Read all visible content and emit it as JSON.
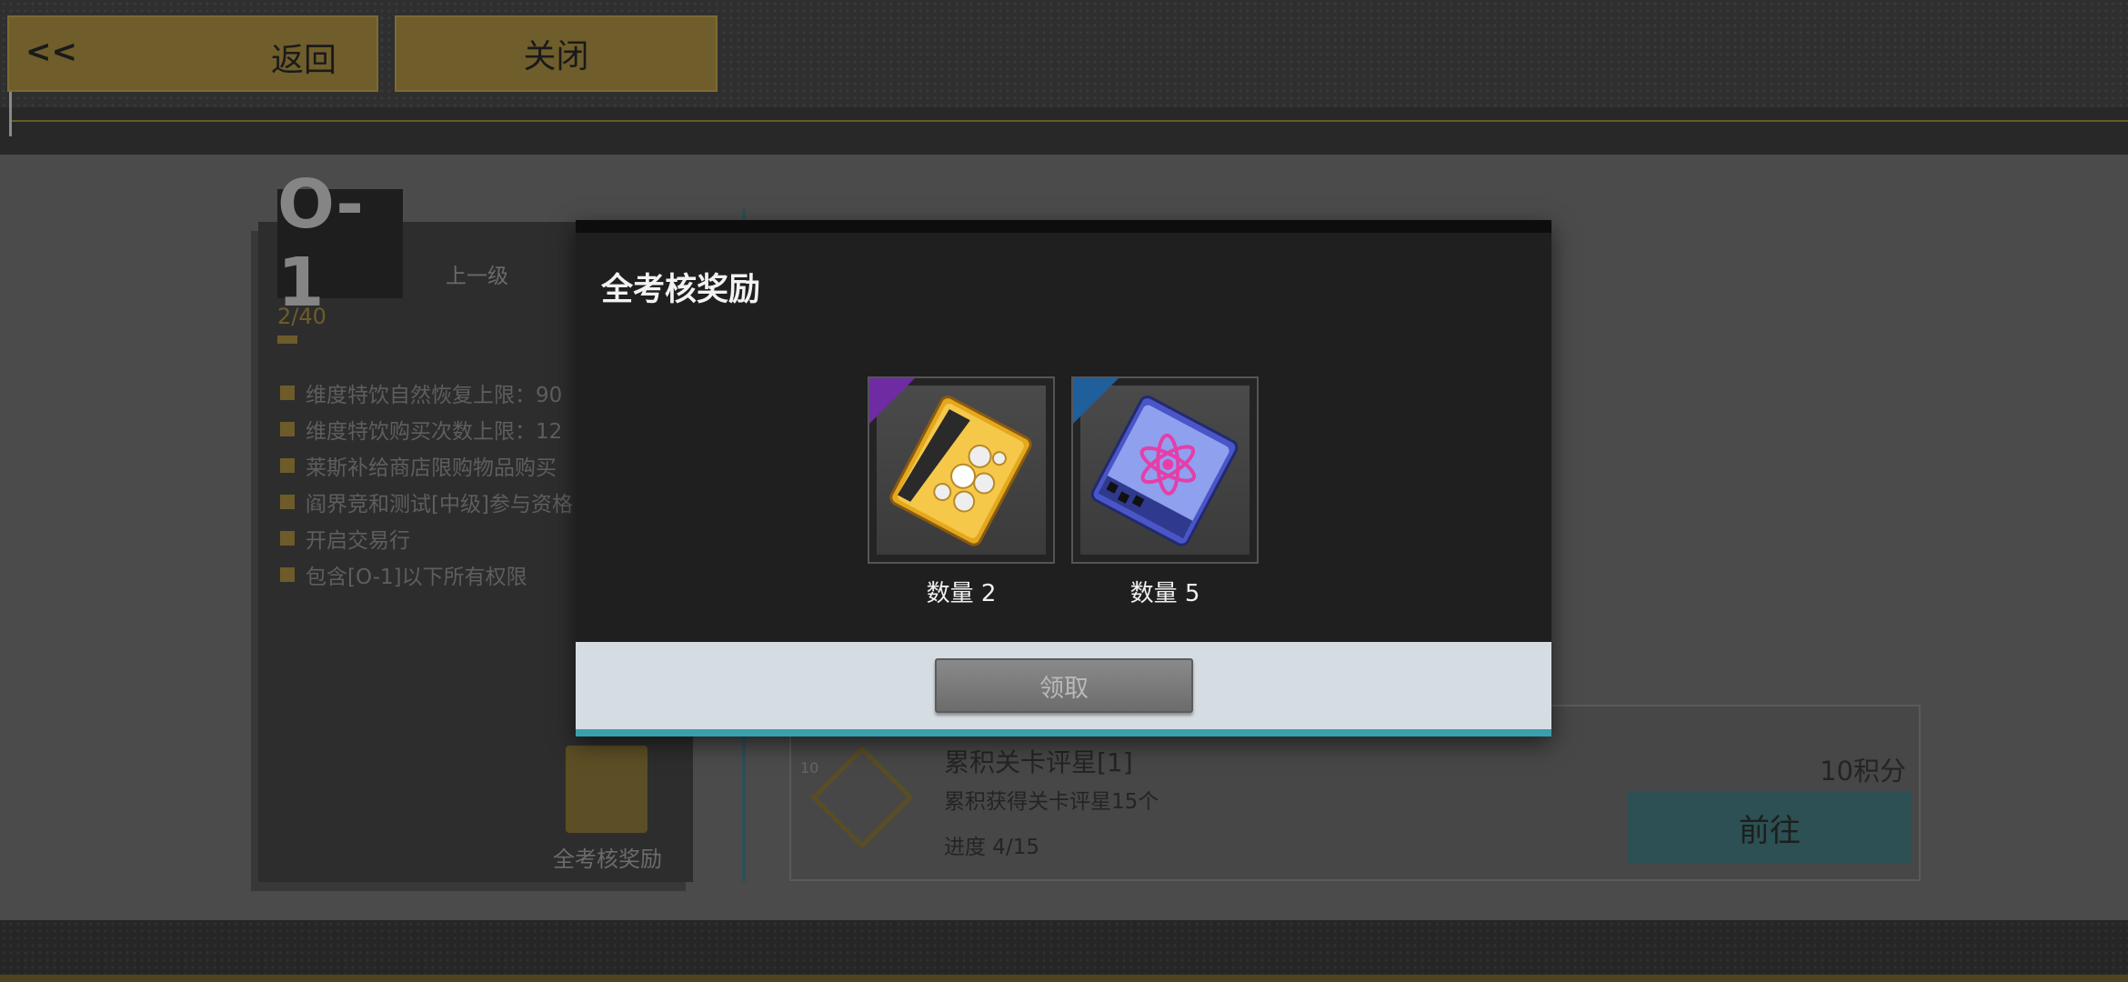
{
  "topbar": {
    "back_arrow": "<<",
    "back_label": "返回",
    "close_label": "关闭"
  },
  "level_panel": {
    "level": "O-1",
    "prev_level_label": "上一级",
    "progress": "2/40",
    "perks": [
      "维度特饮自然恢复上限：90",
      "维度特饮购买次数上限：12",
      "莱斯补给商店限购物品购买",
      "阎界竞和测试[中级]参与资格",
      "开启交易行",
      "包含[O-1]以下所有权限"
    ],
    "all_assess_label": "全考核奖励"
  },
  "task_card": {
    "tier": "10",
    "title": "累积关卡评星[1]",
    "description": "累积获得关卡评星15个",
    "progress": "进度 4/15",
    "points": "10积分",
    "goto_label": "前往"
  },
  "modal": {
    "title": "全考核奖励",
    "rewards": [
      {
        "icon": "gold-ticket-icon",
        "rarity_color": "#6e2ba3",
        "quantity": "数量 2"
      },
      {
        "icon": "atom-pack-icon",
        "rarity_color": "#1f5f9c",
        "quantity": "数量 5"
      }
    ],
    "claim_label": "领取"
  },
  "colors": {
    "accent_gold": "#6f5e2b",
    "accent_teal": "#39a0ad",
    "modal_bg": "#1f1f1f"
  }
}
